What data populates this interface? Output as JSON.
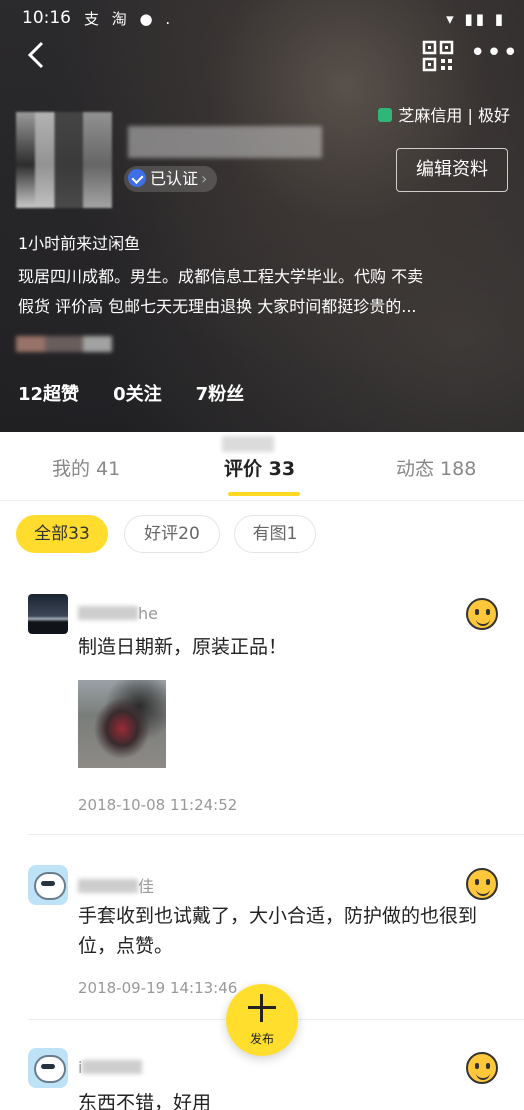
{
  "status_bar": {
    "time": "10:16",
    "app_glyphs": "支 淘 ● .",
    "system_icons": "▾ ▮▮ ▮"
  },
  "profile": {
    "credit_label": "芝麻信用 | 极好",
    "verified_label": "已认证",
    "edit_button": "编辑资料",
    "last_seen": "1小时前来过闲鱼",
    "bio_line1": "现居四川成都。男生。成都信息工程大学毕业。代购 不卖",
    "bio_line2": "假货 评价高 包邮七天无理由退换 大家时间都挺珍贵的...",
    "stats": [
      {
        "label": "12超赞"
      },
      {
        "label": "0关注"
      },
      {
        "label": "7粉丝"
      }
    ]
  },
  "tabs": [
    {
      "label": "我的 41"
    },
    {
      "label": "评价 33"
    },
    {
      "label": "动态 188"
    }
  ],
  "filters": [
    {
      "label": "全部33",
      "selected": true
    },
    {
      "label": "好评20",
      "selected": false
    },
    {
      "label": "有图1",
      "selected": false
    }
  ],
  "reviews": [
    {
      "name_suffix": "he",
      "text": "制造日期新，原装正品！",
      "date": "2018-10-08 11:24:52",
      "has_photo": true
    },
    {
      "name_suffix": "佳",
      "text": "手套收到也试戴了，大小合适，防护做的也很到位，点赞。",
      "date": "2018-09-19 14:13:46",
      "has_photo": false
    },
    {
      "name_suffix": "i",
      "text": "东西不错，好用",
      "date": "",
      "has_photo": false
    }
  ],
  "publish_button": {
    "label": "发布"
  },
  "icons": {
    "back": "back-arrow-icon",
    "qr": "qr-code-icon",
    "more": "more-dots-icon",
    "credit": "sesame-credit-icon",
    "verified": "verified-shield-icon",
    "review_emoji": "smile-thumb-emoji-icon"
  },
  "colors": {
    "accent": "#ffdc2e",
    "credit_green": "#2fb679",
    "verified_blue": "#3f6fe6"
  }
}
